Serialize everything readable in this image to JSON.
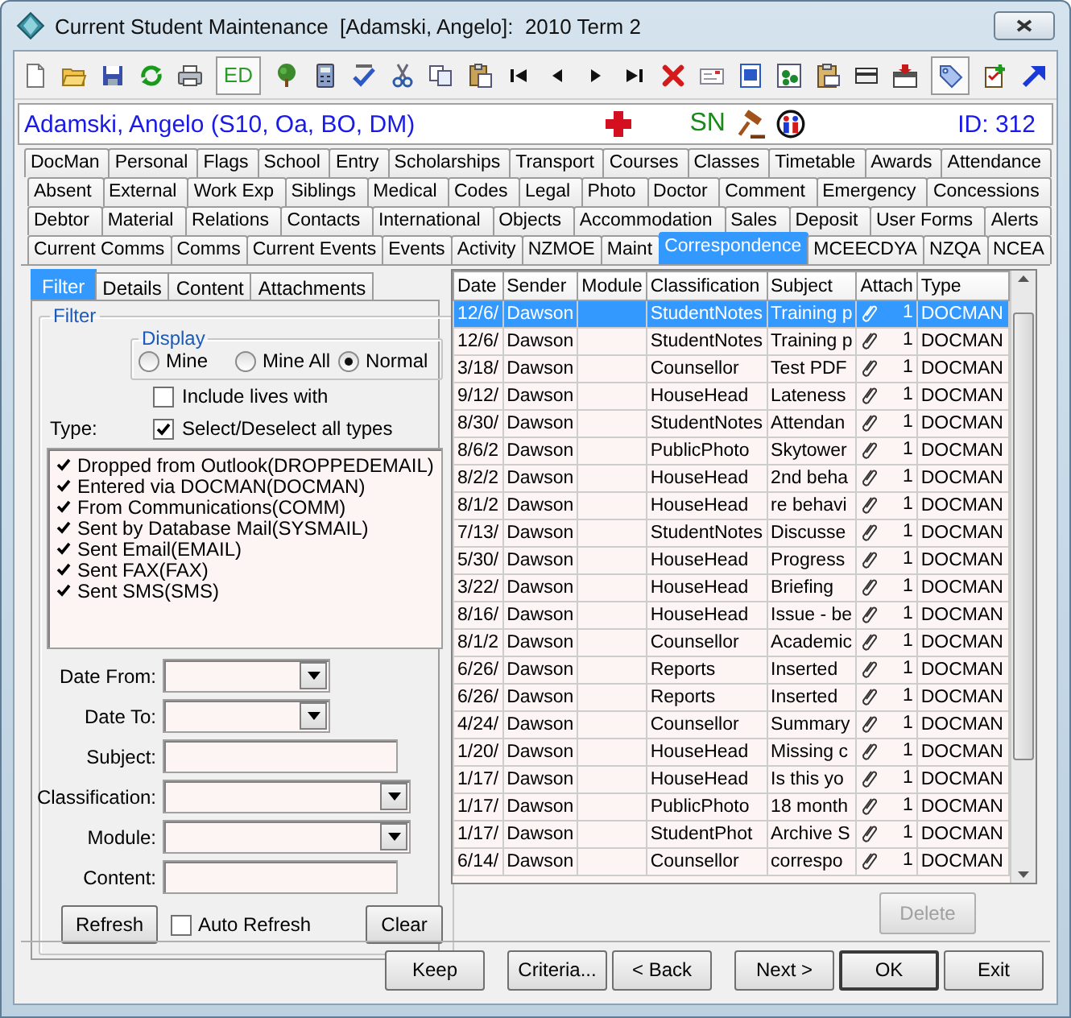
{
  "window": {
    "title": "Current Student Maintenance  [Adamski, Angelo]:  2010 Term 2"
  },
  "toolbar": {
    "text_button": "ED"
  },
  "student": {
    "name": "Adamski, Angelo (S10, Oa, BO, DM)",
    "flag_text": "SN",
    "id": "ID: 312"
  },
  "tab_rows": [
    {
      "tabs": [
        {
          "label": "DocMan",
          "selected": false
        },
        {
          "label": "Personal",
          "selected": false
        },
        {
          "label": "Flags",
          "selected": false
        },
        {
          "label": "School",
          "selected": false
        },
        {
          "label": "Entry",
          "selected": false
        },
        {
          "label": "Scholarships",
          "selected": false
        },
        {
          "label": "Transport",
          "selected": false
        },
        {
          "label": "Courses",
          "selected": false
        },
        {
          "label": "Classes",
          "selected": false
        },
        {
          "label": "Timetable",
          "selected": false
        },
        {
          "label": "Awards",
          "selected": false
        },
        {
          "label": "Attendance",
          "selected": false
        }
      ]
    },
    {
      "tabs": [
        {
          "label": "Absent",
          "selected": false
        },
        {
          "label": "External",
          "selected": false
        },
        {
          "label": "Work Exp",
          "selected": false
        },
        {
          "label": "Siblings",
          "selected": false
        },
        {
          "label": "Medical",
          "selected": false
        },
        {
          "label": "Codes",
          "selected": false
        },
        {
          "label": "Legal",
          "selected": false
        },
        {
          "label": "Photo",
          "selected": false
        },
        {
          "label": "Doctor",
          "selected": false
        },
        {
          "label": "Comment",
          "selected": false
        },
        {
          "label": "Emergency",
          "selected": false
        },
        {
          "label": "Concessions",
          "selected": false
        }
      ]
    },
    {
      "tabs": [
        {
          "label": "Debtor",
          "selected": false
        },
        {
          "label": "Material",
          "selected": false
        },
        {
          "label": "Relations",
          "selected": false
        },
        {
          "label": "Contacts",
          "selected": false
        },
        {
          "label": "International",
          "selected": false
        },
        {
          "label": "Objects",
          "selected": false
        },
        {
          "label": "Accommodation",
          "selected": false
        },
        {
          "label": "Sales",
          "selected": false
        },
        {
          "label": "Deposit",
          "selected": false
        },
        {
          "label": "User Forms",
          "selected": false
        },
        {
          "label": "Alerts",
          "selected": false
        }
      ]
    },
    {
      "tabs": [
        {
          "label": "Current Comms",
          "selected": false
        },
        {
          "label": "Comms",
          "selected": false
        },
        {
          "label": "Current Events",
          "selected": false
        },
        {
          "label": "Events",
          "selected": false
        },
        {
          "label": "Activity",
          "selected": false
        },
        {
          "label": "NZMOE",
          "selected": false
        },
        {
          "label": "Maint",
          "selected": false
        },
        {
          "label": "Correspondence",
          "selected": true
        },
        {
          "label": "MCEECDYA",
          "selected": false
        },
        {
          "label": "NZQA",
          "selected": false
        },
        {
          "label": "NCEA",
          "selected": false
        }
      ]
    }
  ],
  "sub_tabs": [
    {
      "label": "Filter",
      "selected": true
    },
    {
      "label": "Details",
      "selected": false
    },
    {
      "label": "Content",
      "selected": false
    },
    {
      "label": "Attachments",
      "selected": false
    }
  ],
  "filter": {
    "title": "Filter",
    "display": {
      "title": "Display",
      "options": [
        {
          "label": "Mine",
          "selected": false
        },
        {
          "label": "Mine All",
          "selected": false
        },
        {
          "label": "Normal",
          "selected": true
        }
      ]
    },
    "include_lives_with": {
      "label": "Include lives with",
      "checked": false
    },
    "type_label": "Type:",
    "select_all": {
      "label": "Select/Deselect all types",
      "checked": true
    },
    "types": [
      {
        "label": "Dropped from Outlook(DROPPEDEMAIL)",
        "checked": true
      },
      {
        "label": "Entered via DOCMAN(DOCMAN)",
        "checked": true
      },
      {
        "label": "From Communications(COMM)",
        "checked": true
      },
      {
        "label": "Sent by Database Mail(SYSMAIL)",
        "checked": true
      },
      {
        "label": "Sent Email(EMAIL)",
        "checked": true
      },
      {
        "label": "Sent FAX(FAX)",
        "checked": true
      },
      {
        "label": "Sent SMS(SMS)",
        "checked": true
      }
    ],
    "fields": [
      {
        "label": "Date From:",
        "kind": "date"
      },
      {
        "label": "Date To:",
        "kind": "date"
      },
      {
        "label": "Subject:",
        "kind": "text"
      },
      {
        "label": "Classification:",
        "kind": "combo"
      },
      {
        "label": "Module:",
        "kind": "combo"
      },
      {
        "label": "Content:",
        "kind": "text"
      }
    ],
    "refresh_button": "Refresh",
    "auto_refresh": {
      "label": "Auto Refresh",
      "checked": false
    },
    "clear_button": "Clear"
  },
  "table": {
    "columns": [
      "Date",
      "Sender",
      "Module",
      "Classification",
      "Subject",
      "Attach",
      "Type"
    ],
    "rows": [
      {
        "date": "12/6/",
        "sender": "Dawson",
        "classification": "StudentNotes",
        "subject": "Training p",
        "attach": "1",
        "type": "DOCMAN",
        "selected": true
      },
      {
        "date": "12/6/",
        "sender": "Dawson",
        "classification": "StudentNotes",
        "subject": "Training p",
        "attach": "1",
        "type": "DOCMAN",
        "selected": false
      },
      {
        "date": "3/18/",
        "sender": "Dawson",
        "classification": "Counsellor",
        "subject": "Test PDF",
        "attach": "1",
        "type": "DOCMAN",
        "selected": false
      },
      {
        "date": "9/12/",
        "sender": "Dawson",
        "classification": "HouseHead",
        "subject": "Lateness",
        "attach": "1",
        "type": "DOCMAN",
        "selected": false
      },
      {
        "date": "8/30/",
        "sender": "Dawson",
        "classification": "StudentNotes",
        "subject": "Attendan",
        "attach": "1",
        "type": "DOCMAN",
        "selected": false
      },
      {
        "date": "8/6/2",
        "sender": "Dawson",
        "classification": "PublicPhoto",
        "subject": "Skytower",
        "attach": "1",
        "type": "DOCMAN",
        "selected": false
      },
      {
        "date": "8/2/2",
        "sender": "Dawson",
        "classification": "HouseHead",
        "subject": "2nd beha",
        "attach": "1",
        "type": "DOCMAN",
        "selected": false
      },
      {
        "date": "8/1/2",
        "sender": "Dawson",
        "classification": "HouseHead",
        "subject": "re behavi",
        "attach": "1",
        "type": "DOCMAN",
        "selected": false
      },
      {
        "date": "7/13/",
        "sender": "Dawson",
        "classification": "StudentNotes",
        "subject": "Discusse",
        "attach": "1",
        "type": "DOCMAN",
        "selected": false
      },
      {
        "date": "5/30/",
        "sender": "Dawson",
        "classification": "HouseHead",
        "subject": "Progress",
        "attach": "1",
        "type": "DOCMAN",
        "selected": false
      },
      {
        "date": "3/22/",
        "sender": "Dawson",
        "classification": "HouseHead",
        "subject": "Briefing",
        "attach": "1",
        "type": "DOCMAN",
        "selected": false
      },
      {
        "date": "8/16/",
        "sender": "Dawson",
        "classification": "HouseHead",
        "subject": "Issue - be",
        "attach": "1",
        "type": "DOCMAN",
        "selected": false
      },
      {
        "date": "8/1/2",
        "sender": "Dawson",
        "classification": "Counsellor",
        "subject": "Academic",
        "attach": "1",
        "type": "DOCMAN",
        "selected": false
      },
      {
        "date": "6/26/",
        "sender": "Dawson",
        "classification": "Reports",
        "subject": "Inserted",
        "attach": "1",
        "type": "DOCMAN",
        "selected": false
      },
      {
        "date": "6/26/",
        "sender": "Dawson",
        "classification": "Reports",
        "subject": "Inserted",
        "attach": "1",
        "type": "DOCMAN",
        "selected": false
      },
      {
        "date": "4/24/",
        "sender": "Dawson",
        "classification": "Counsellor",
        "subject": "Summary",
        "attach": "1",
        "type": "DOCMAN",
        "selected": false
      },
      {
        "date": "1/20/",
        "sender": "Dawson",
        "classification": "HouseHead",
        "subject": "Missing c",
        "attach": "1",
        "type": "DOCMAN",
        "selected": false
      },
      {
        "date": "1/17/",
        "sender": "Dawson",
        "classification": "HouseHead",
        "subject": "Is this yo",
        "attach": "1",
        "type": "DOCMAN",
        "selected": false
      },
      {
        "date": "1/17/",
        "sender": "Dawson",
        "classification": "PublicPhoto",
        "subject": "18 month",
        "attach": "1",
        "type": "DOCMAN",
        "selected": false
      },
      {
        "date": "1/17/",
        "sender": "Dawson",
        "classification": "StudentPhot",
        "subject": "Archive S",
        "attach": "1",
        "type": "DOCMAN",
        "selected": false
      },
      {
        "date": "6/14/",
        "sender": "Dawson",
        "classification": "Counsellor",
        "subject": "correspo",
        "attach": "1",
        "type": "DOCMAN",
        "selected": false
      }
    ]
  },
  "delete_button": {
    "label": "Delete",
    "disabled": true
  },
  "buttons": [
    {
      "label": "Keep",
      "default": false
    },
    {
      "label": "Criteria...",
      "default": false
    },
    {
      "label": "< Back",
      "default": false
    },
    {
      "label": "Next >",
      "default": false
    },
    {
      "label": "OK",
      "default": true
    },
    {
      "label": "Exit",
      "default": false
    }
  ]
}
